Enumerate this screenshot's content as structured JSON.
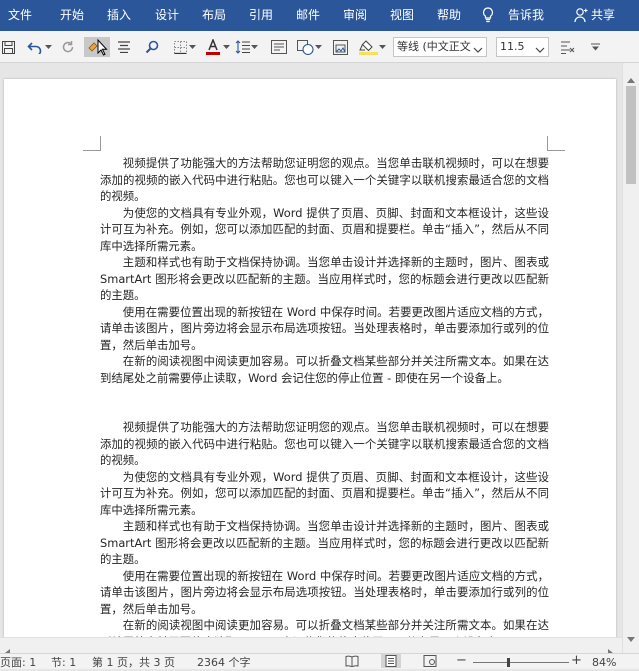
{
  "menu": {
    "file": "文件",
    "home": "开始",
    "insert": "插入",
    "design": "设计",
    "layout": "布局",
    "references": "引用",
    "mailings": "邮件",
    "review": "审阅",
    "view": "视图",
    "help": "帮助",
    "tell_me": "告诉我",
    "share": "共享"
  },
  "toolbar": {
    "font_name": "等线 (中文正文",
    "font_size": "11.5"
  },
  "document": {
    "paragraphs": [
      "视频提供了功能强大的方法帮助您证明您的观点。当您单击联机视频时，可以在想要添加的视频的嵌入代码中进行粘贴。您也可以键入一个关键字以联机搜索最适合您的文档的视频。",
      "为使您的文档具有专业外观，Word 提供了页眉、页脚、封面和文本框设计，这些设计可互为补充。例如，您可以添加匹配的封面、页眉和提要栏。单击“插入”，然后从不同库中选择所需元素。",
      "主题和样式也有助于文档保持协调。当您单击设计并选择新的主题时，图片、图表或 SmartArt 图形将会更改以匹配新的主题。当应用样式时，您的标题会进行更改以匹配新的主题。",
      "使用在需要位置出现的新按钮在 Word 中保存时间。若要更改图片适应文档的方式，请单击该图片，图片旁边将会显示布局选项按钮。当处理表格时，单击要添加行或列的位置，然后单击加号。",
      "在新的阅读视图中阅读更加容易。可以折叠文档某些部分并关注所需文本。如果在达到结尾处之前需要停止读取，Word 会记住您的停止位置 - 即使在另一个设备上。"
    ]
  },
  "status": {
    "page": "页面: 1",
    "section": "节: 1",
    "page_of": "第 1 页，共 3 页",
    "words": "2364 个字",
    "zoom": "84%"
  }
}
